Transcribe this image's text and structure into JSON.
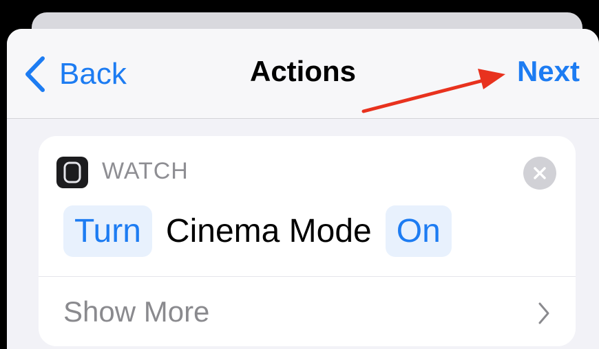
{
  "navbar": {
    "back_label": "Back",
    "title": "Actions",
    "next_label": "Next"
  },
  "action": {
    "app_name": "WATCH",
    "token_turn": "Turn",
    "text": "Cinema Mode",
    "token_state": "On",
    "show_more_label": "Show More"
  },
  "icons": {
    "back": "chevron-left-icon",
    "app": "apple-watch-icon",
    "close": "close-icon",
    "show_more": "chevron-right-icon"
  },
  "colors": {
    "accent": "#1d7cf2",
    "annotation_arrow": "#e8321e"
  }
}
